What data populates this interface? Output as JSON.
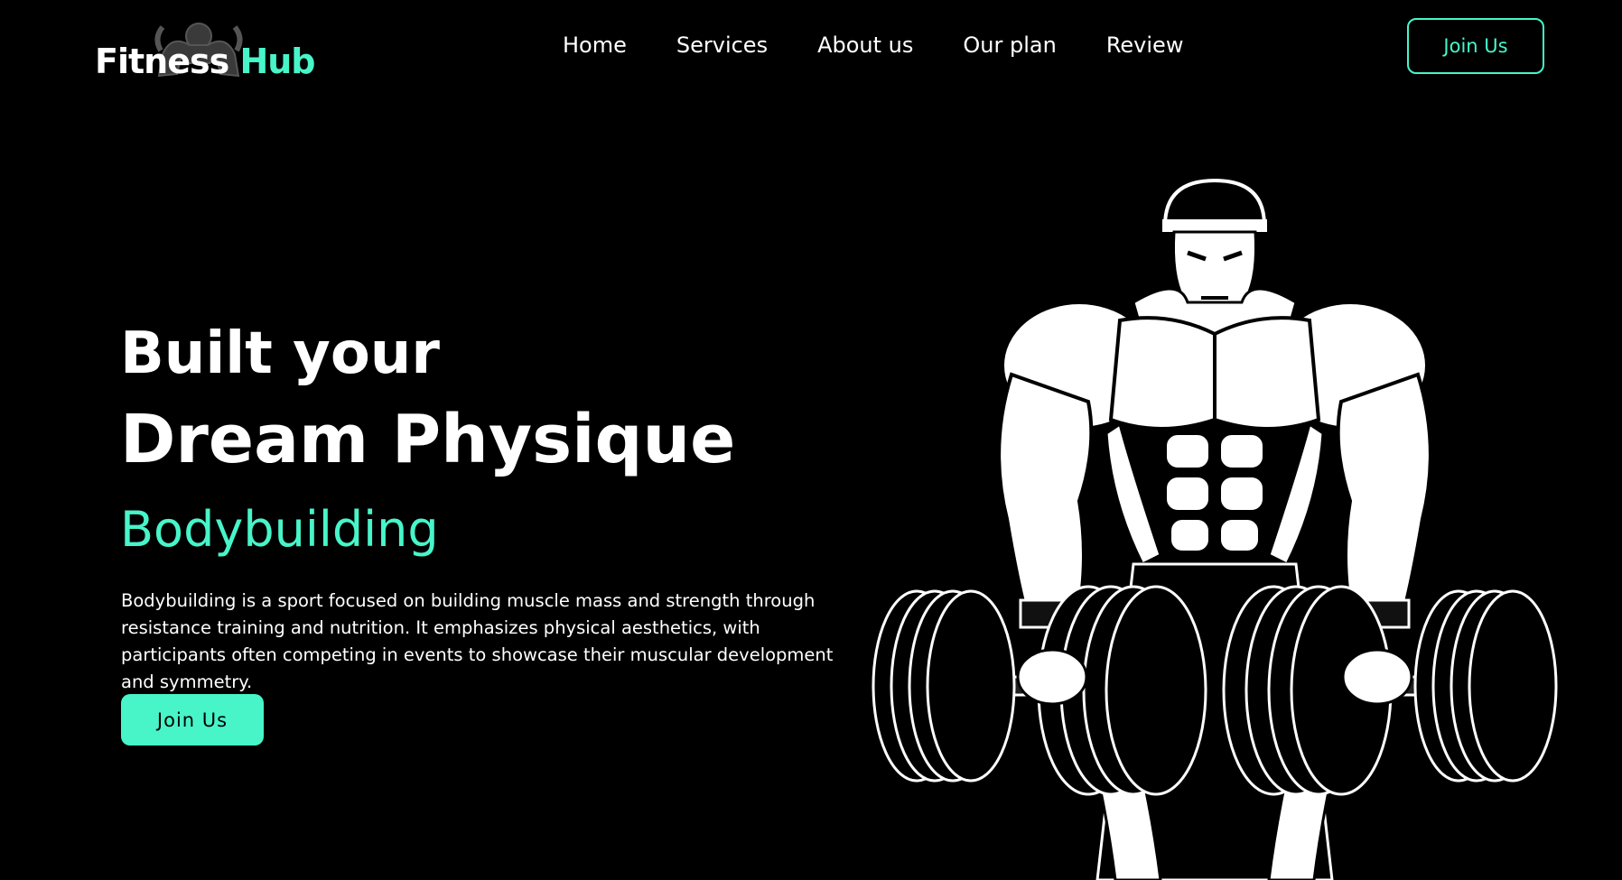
{
  "brand": {
    "word1": "Fitness",
    "word2": "Hub",
    "accent_color": "#47f5c9",
    "icon": "bodybuilder-silhouette-icon"
  },
  "nav": {
    "items": [
      {
        "label": "Home"
      },
      {
        "label": "Services"
      },
      {
        "label": "About us"
      },
      {
        "label": "Our plan"
      },
      {
        "label": "Review"
      }
    ],
    "join_label": "Join Us"
  },
  "hero": {
    "line1": "Built your",
    "line2": "Dream Physique",
    "line3": "Bodybuilding",
    "description": "Bodybuilding is a sport focused on building muscle mass and strength through resistance training and nutrition. It emphasizes physical aesthetics, with participants often competing in events to showcase their muscular development and symmetry.",
    "cta_label": "Join Us",
    "illustration": "bodybuilder-with-dumbbells-illustration"
  },
  "colors": {
    "background": "#000000",
    "accent": "#47f5c9",
    "text": "#ffffff"
  }
}
